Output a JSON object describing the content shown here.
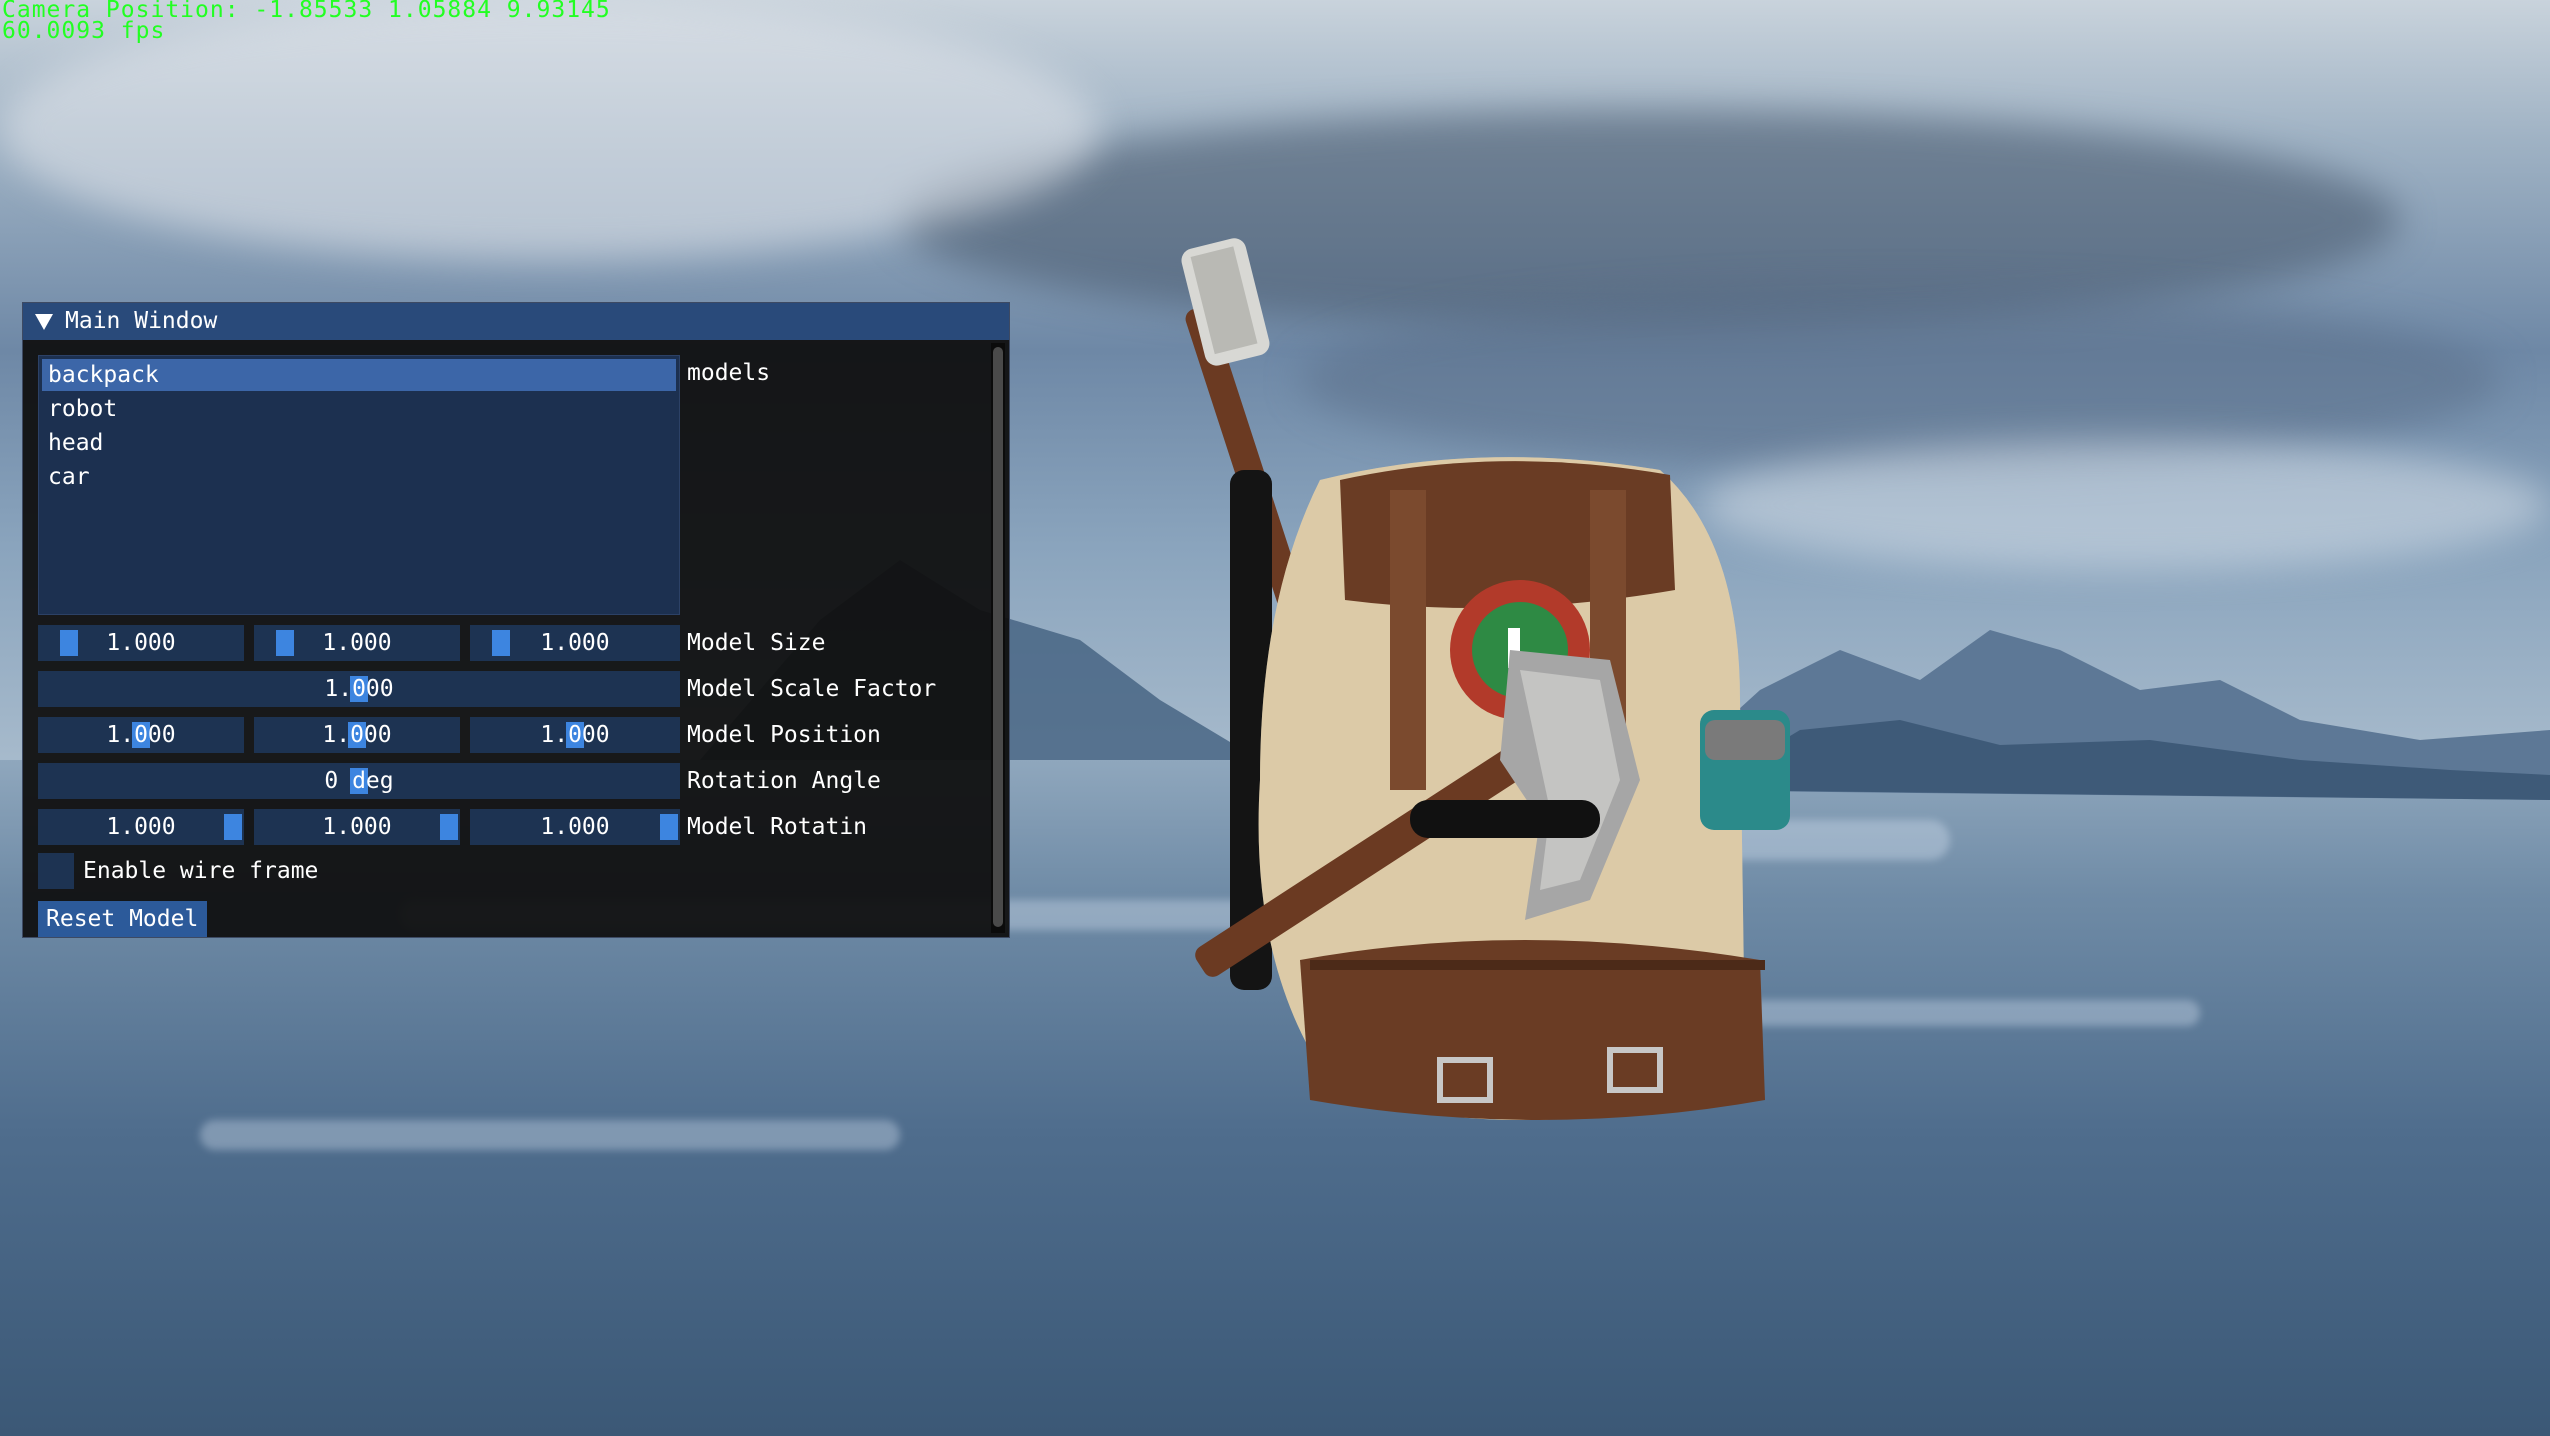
{
  "hud": {
    "camera_position": "Camera Position: -1.85533 1.05884 9.93145",
    "fps": "60.0093 fps"
  },
  "window": {
    "title": "Main Window",
    "models_label": "models",
    "models": [
      "backpack",
      "robot",
      "head",
      "car"
    ],
    "selected_model": "backpack",
    "model_size": {
      "label": "Model Size",
      "values": [
        "1.000",
        "1.000",
        "1.000"
      ]
    },
    "model_scale_factor": {
      "label": "Model Scale Factor",
      "value": "1.000"
    },
    "model_position": {
      "label": "Model Position",
      "values": [
        "1.000",
        "1.000",
        "1.000"
      ]
    },
    "rotation_angle": {
      "label": "Rotation Angle",
      "value": "0 deg"
    },
    "model_rotation": {
      "label": "Model Rotatin",
      "values": [
        "1.000",
        "1.000",
        "1.000"
      ]
    },
    "wireframe": {
      "label": "Enable wire frame",
      "checked": false
    },
    "reset_button": "Reset Model"
  },
  "colors": {
    "hud_text": "#22ff22",
    "title_bar": "#294a7a",
    "slider_grab": "#3d85e0",
    "frame_bg": "#1d3352",
    "selected_item": "#3c66a8"
  }
}
